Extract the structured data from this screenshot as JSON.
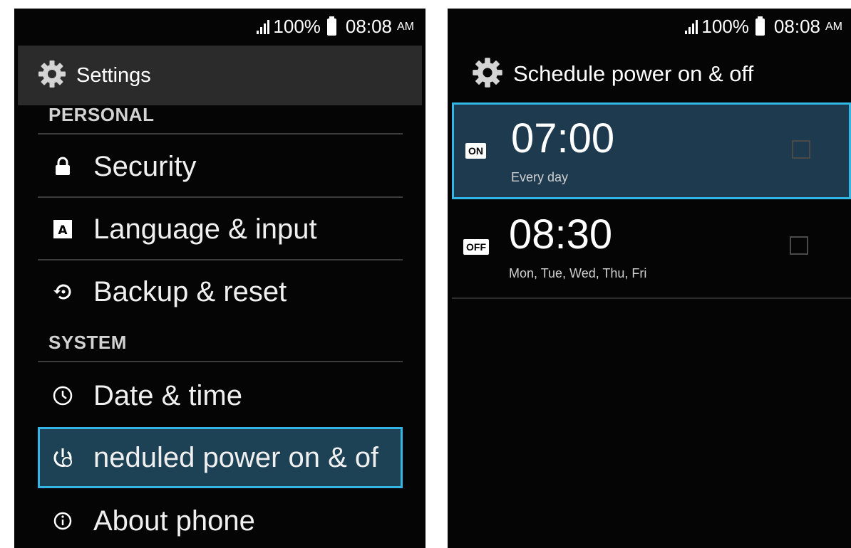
{
  "status": {
    "signal_icon": "signal-icon",
    "battery_pct": "100%",
    "battery_icon": "battery-icon",
    "time": "08:08",
    "ampm": "AM"
  },
  "settings": {
    "title": "Settings",
    "title_icon": "gear-icon",
    "sections": [
      {
        "header": "PERSONAL"
      },
      {
        "header": "SYSTEM"
      }
    ],
    "items": [
      {
        "label": "Security",
        "icon": "lock-icon"
      },
      {
        "label": "Language & input",
        "icon": "language-icon"
      },
      {
        "label": "Backup & reset",
        "icon": "backup-reset-icon"
      },
      {
        "label": "Date & time",
        "icon": "clock-icon"
      },
      {
        "label": "neduled power on & of",
        "icon": "scheduled-power-icon",
        "selected": true
      },
      {
        "label": "About phone",
        "icon": "info-icon"
      }
    ]
  },
  "schedule": {
    "title": "Schedule power on & off",
    "title_icon": "gear-icon",
    "items": [
      {
        "state": "ON",
        "time": "07:00",
        "days": "Every day",
        "checked": false,
        "selected": true
      },
      {
        "state": "OFF",
        "time": "08:30",
        "days": "Mon, Tue, Wed, Thu, Fri",
        "checked": false,
        "selected": false
      }
    ]
  },
  "colors": {
    "accent": "#33b5e5",
    "selected_bg": "#1d4256",
    "background": "#050505",
    "action_bar": "#2b2b2b"
  }
}
